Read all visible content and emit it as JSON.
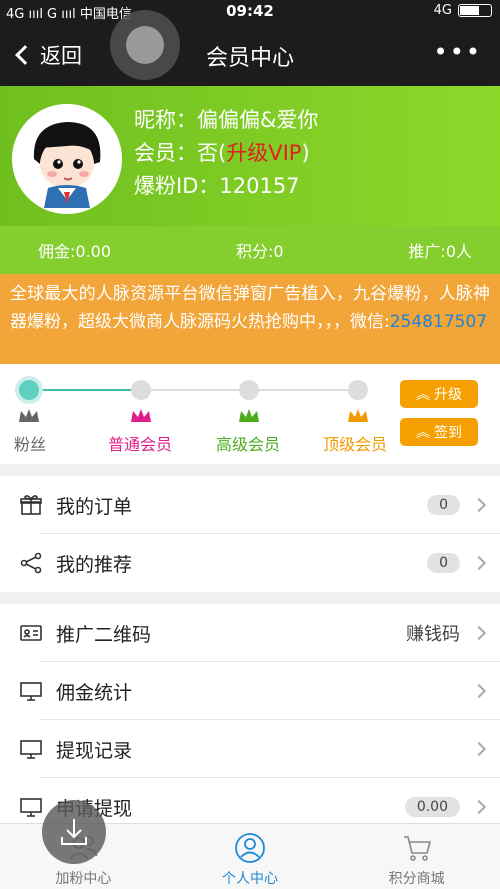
{
  "status": {
    "carrier": "4G ıııl G ıııl 中国电信",
    "time": "09:42",
    "network": "4G"
  },
  "nav": {
    "back_label": "返回",
    "title": "会员中心",
    "more": "•••"
  },
  "profile": {
    "nickname_label": "昵称：",
    "nickname": "偏偏偏&爱你",
    "member_label": "会员：",
    "member_value": "否(",
    "upgrade_text": "升级VIP",
    "member_close": ")",
    "id_label": "爆粉ID：",
    "id": "120157"
  },
  "stats": {
    "commission": "佣金:0.00",
    "points": "积分:0",
    "promotion": "推广:0人"
  },
  "notice": {
    "text": "全球最大的人脉资源平台微信弹窗广告植入，九谷爆粉，人脉神器爆粉，超级大微商人脉源码火热抢购中，，，微信:",
    "wechat": "254817507"
  },
  "levels": {
    "items": [
      {
        "label": "粉丝",
        "color": "#666666"
      },
      {
        "label": "普通会员",
        "color": "#e0208a"
      },
      {
        "label": "高级会员",
        "color": "#4cae1e"
      },
      {
        "label": "顶级会员",
        "color": "#f09a00"
      }
    ],
    "upgrade_button": "升级",
    "checkin_button": "签到"
  },
  "menu1": [
    {
      "label": "我的订单",
      "badge": "0",
      "icon": "gift-icon"
    },
    {
      "label": "我的推荐",
      "badge": "0",
      "icon": "share-icon"
    }
  ],
  "menu2": [
    {
      "label": "推广二维码",
      "right_text": "赚钱码",
      "icon": "id-card-icon"
    },
    {
      "label": "佣金统计",
      "icon": "monitor-icon"
    },
    {
      "label": "提现记录",
      "icon": "monitor-icon"
    },
    {
      "label": "申请提现",
      "badge": "0.00",
      "icon": "monitor-icon"
    }
  ],
  "tabbar": {
    "tabs": [
      {
        "label": "加粉中心"
      },
      {
        "label": "个人中心"
      },
      {
        "label": "积分商城"
      }
    ],
    "active_color": "#1e8ad6"
  }
}
